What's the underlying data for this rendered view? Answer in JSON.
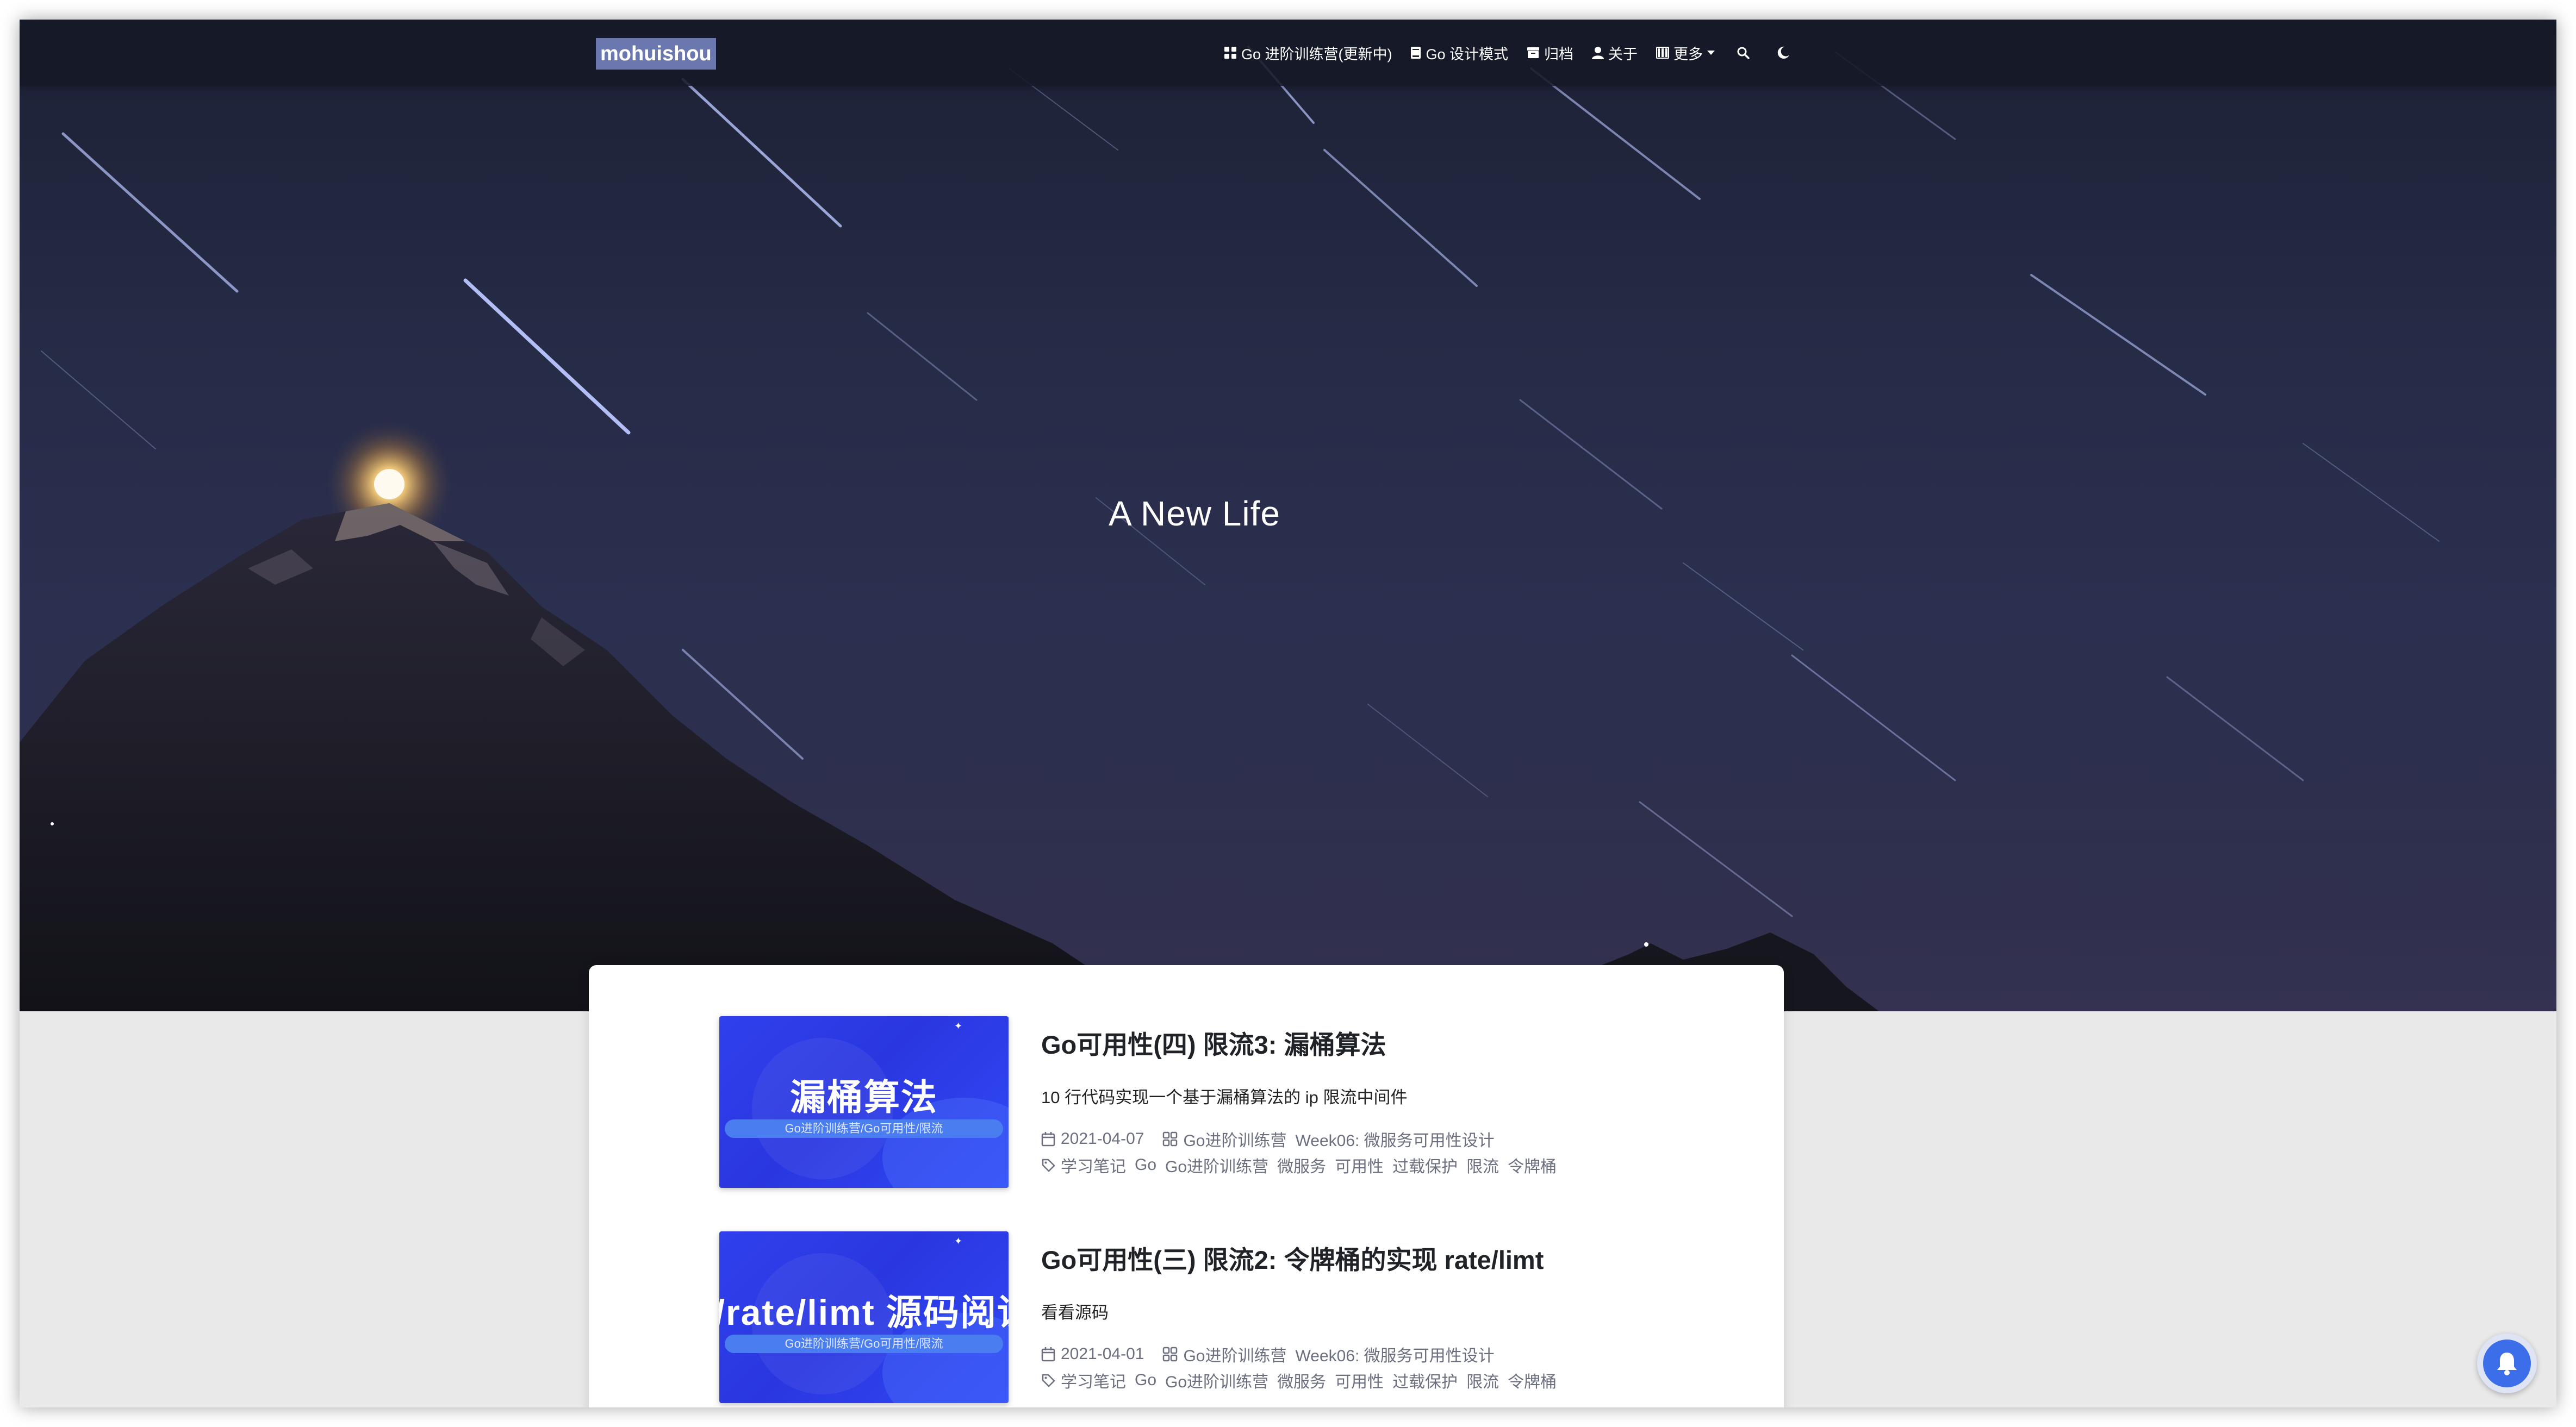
{
  "navbar": {
    "brand": "mohuishou",
    "items": [
      {
        "label": "Go 进阶训练营(更新中)",
        "icon": "grid-icon"
      },
      {
        "label": "Go 设计模式",
        "icon": "book-icon"
      },
      {
        "label": "归档",
        "icon": "archive-icon"
      },
      {
        "label": "关于",
        "icon": "user-icon"
      },
      {
        "label": "更多",
        "icon": "columns-icon"
      }
    ],
    "search_icon": "search-icon",
    "theme_icon": "moon-icon"
  },
  "hero": {
    "title": "A New Life"
  },
  "posts": [
    {
      "thumb_title": "漏桶算法",
      "thumb_subtitle": "Go进阶训练营/Go可用性/限流",
      "title": "Go可用性(四) 限流3: 漏桶算法",
      "summary": "10 行代码实现一个基于漏桶算法的 ip 限流中间件",
      "date": "2021-04-07",
      "categories": [
        "Go进阶训练营",
        "Week06: 微服务可用性设计"
      ],
      "tags": [
        "学习笔记",
        "Go",
        "Go进阶训练营",
        "微服务",
        "可用性",
        "过载保护",
        "限流",
        "令牌桶"
      ]
    },
    {
      "thumb_title": "x/rate/limt 源码阅读",
      "thumb_subtitle": "Go进阶训练营/Go可用性/限流",
      "title": "Go可用性(三) 限流2: 令牌桶的实现 rate/limt",
      "summary": "看看源码",
      "date": "2021-04-01",
      "categories": [
        "Go进阶训练营",
        "Week06: 微服务可用性设计"
      ],
      "tags": [
        "学习笔记",
        "Go",
        "Go进阶训练营",
        "微服务",
        "可用性",
        "过载保护",
        "限流",
        "令牌桶"
      ]
    }
  ],
  "notification_icon": "bell-icon"
}
